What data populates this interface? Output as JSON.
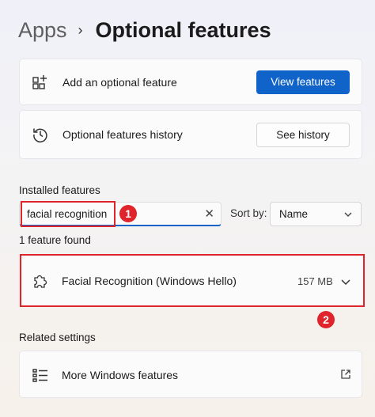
{
  "breadcrumb": {
    "root": "Apps",
    "separator": "›",
    "current": "Optional features"
  },
  "add_feature": {
    "label": "Add an optional feature",
    "button": "View features"
  },
  "history": {
    "label": "Optional features history",
    "button": "See history"
  },
  "installed": {
    "title": "Installed features",
    "search_value": "facial recognition",
    "sort_label": "Sort by:",
    "sort_value": "Name",
    "result_count": "1 feature found",
    "features": [
      {
        "name": "Facial Recognition (Windows Hello)",
        "size": "157 MB"
      }
    ]
  },
  "related": {
    "title": "Related settings",
    "more_windows_features": "More Windows features"
  },
  "annotations": {
    "badge1": "1",
    "badge2": "2"
  },
  "colors": {
    "accent": "#0f63c9",
    "callout": "#e0242b"
  },
  "icons": [
    "chevron-right-icon",
    "add-grid-icon",
    "history-icon",
    "clear-icon",
    "chevron-down-icon",
    "puzzle-icon",
    "list-icon",
    "open-external-icon"
  ]
}
